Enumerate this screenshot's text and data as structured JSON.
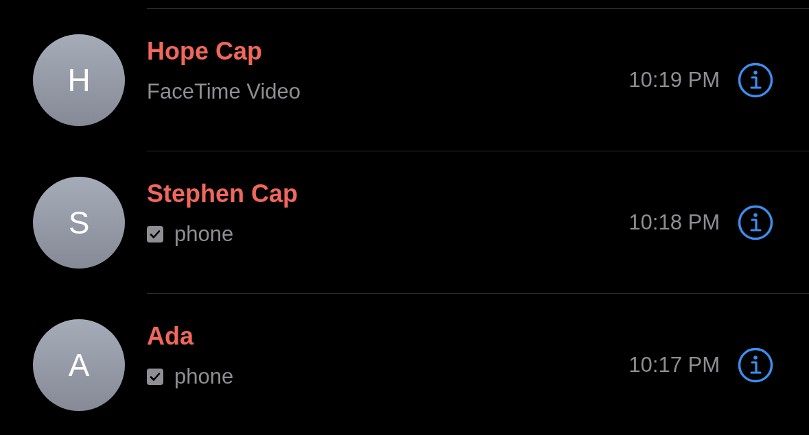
{
  "calls": [
    {
      "initial": "H",
      "name": "Hope Cap",
      "detail": "FaceTime Video",
      "kind": "plain",
      "time": "10:19 PM"
    },
    {
      "initial": "S",
      "name": "Stephen Cap",
      "detail": "phone",
      "kind": "device",
      "time": "10:18 PM"
    },
    {
      "initial": "A",
      "name": "Ada",
      "detail": "phone",
      "kind": "device",
      "time": "10:17 PM"
    }
  ]
}
